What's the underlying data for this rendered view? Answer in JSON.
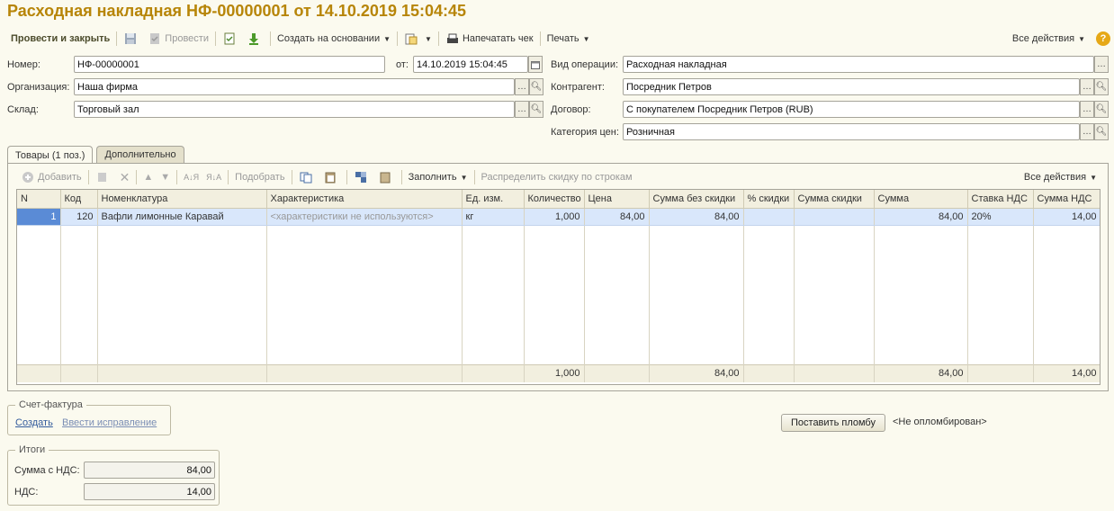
{
  "title": "Расходная накладная НФ-00000001 от 14.10.2019 15:04:45",
  "toolbar": {
    "post_close": "Провести и закрыть",
    "post": "Провести",
    "create_based": "Создать на основании",
    "print_receipt": "Напечатать чек",
    "print": "Печать",
    "all_actions": "Все действия",
    "help": "?"
  },
  "form": {
    "number_label": "Номер:",
    "number_value": "НФ-00000001",
    "date_label": "от:",
    "date_value": "14.10.2019 15:04:45",
    "operation_label": "Вид операции:",
    "operation_value": "Расходная накладная",
    "org_label": "Организация:",
    "org_value": "Наша фирма",
    "counterparty_label": "Контрагент:",
    "counterparty_value": "Посредник Петров",
    "warehouse_label": "Склад:",
    "warehouse_value": "Торговый зал",
    "contract_label": "Договор:",
    "contract_value": "С покупателем Посредник Петров (RUB)",
    "price_cat_label": "Категория цен:",
    "price_cat_value": "Розничная"
  },
  "tabs": [
    "Товары (1 поз.)",
    "Дополнительно"
  ],
  "table_toolbar": {
    "add": "Добавить",
    "pick": "Подобрать",
    "fill": "Заполнить",
    "distribute": "Распределить скидку по строкам",
    "all_actions": "Все действия"
  },
  "table": {
    "columns": [
      "N",
      "Код",
      "Номенклатура",
      "Характеристика",
      "Ед. изм.",
      "Количество",
      "Цена",
      "Сумма без скидки",
      "% скидки",
      "Сумма скидки",
      "Сумма",
      "Ставка НДС",
      "Сумма НДС"
    ],
    "rows": [
      {
        "n": "1",
        "code": "120",
        "name": "Вафли лимонные Каравай",
        "characteristic": "<характеристики не используются>",
        "unit": "кг",
        "qty": "1,000",
        "price": "84,00",
        "sum_no_disc": "84,00",
        "disc_pct": "",
        "disc_sum": "",
        "sum": "84,00",
        "vat_rate": "20%",
        "vat_sum": "14,00"
      }
    ],
    "totals": {
      "qty": "1,000",
      "sum_no_disc": "84,00",
      "sum": "84,00",
      "vat_sum": "14,00"
    }
  },
  "invoice": {
    "title": "Счет-фактура",
    "create": "Создать",
    "correction": "Ввести исправление"
  },
  "seal": {
    "button": "Поставить пломбу",
    "status": "<Не опломбирован>"
  },
  "totals_box": {
    "title": "Итоги",
    "sum_vat_label": "Сумма с НДС:",
    "sum_vat_value": "84,00",
    "vat_label": "НДС:",
    "vat_value": "14,00"
  },
  "colors": {
    "title": "#b78508",
    "selection": "#d9e7fb",
    "row_marker": "#5a8bd6"
  }
}
